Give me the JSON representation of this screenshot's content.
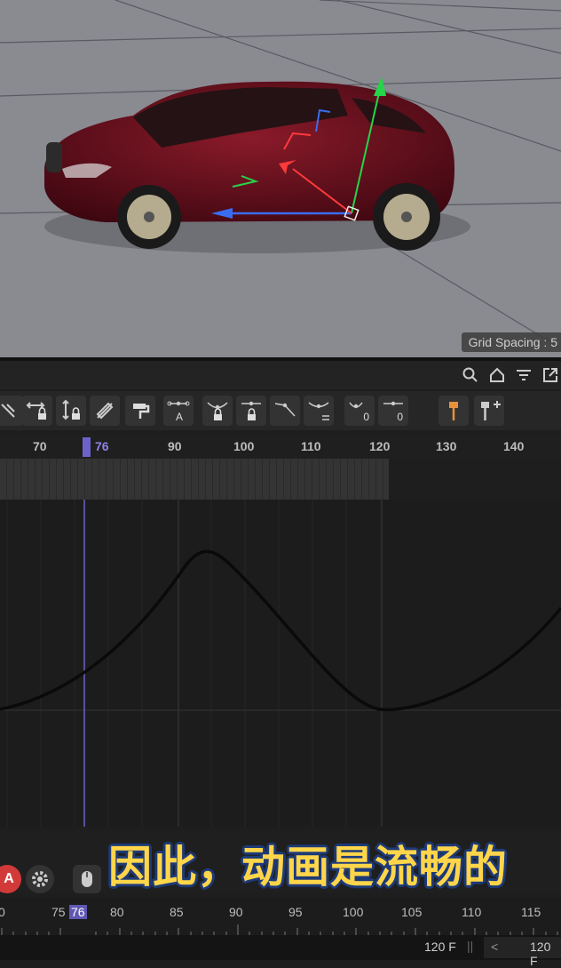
{
  "viewport": {
    "grid_spacing_label": "Grid Spacing : 5"
  },
  "header_icons": [
    "search-icon",
    "home-icon",
    "filter-icon",
    "expand-icon"
  ],
  "toolbar": {
    "tools": [
      {
        "name": "tangent-break-icon"
      },
      {
        "name": "lock-horizontal-icon"
      },
      {
        "name": "lock-vertical-icon"
      },
      {
        "name": "edit-tangent-icon"
      },
      {
        "name": "paint-roller-icon"
      },
      {
        "name": "auto-tangent-icon",
        "label": "A"
      },
      {
        "name": "lock-tangent-angle-icon"
      },
      {
        "name": "lock-tangent-length-icon"
      },
      {
        "name": "linear-tangent-icon"
      },
      {
        "name": "equal-tangent-icon"
      },
      {
        "name": "zero-angle-icon",
        "label": "0"
      },
      {
        "name": "zero-length-icon",
        "label": "0"
      },
      {
        "name": "marker-icon"
      },
      {
        "name": "add-marker-icon"
      }
    ]
  },
  "ruler": {
    "ticks": [
      "70",
      "76",
      "90",
      "100",
      "110",
      "120",
      "130",
      "140"
    ],
    "current": "76"
  },
  "caption": "因此，动画是流畅的",
  "timeline": {
    "ticks": [
      "0",
      "75",
      "76",
      "80",
      "85",
      "90",
      "95",
      "100",
      "105",
      "110",
      "115"
    ],
    "current": "76"
  },
  "status": {
    "end_frame": "120 F",
    "end_frame_right": "120 F"
  },
  "colors": {
    "accent": "#7a71d9",
    "viewport_bg": "#8a8a91",
    "panel_bg": "#1c1c1c",
    "caption_fill": "#ffd54a",
    "caption_stroke": "#1d3a78"
  }
}
